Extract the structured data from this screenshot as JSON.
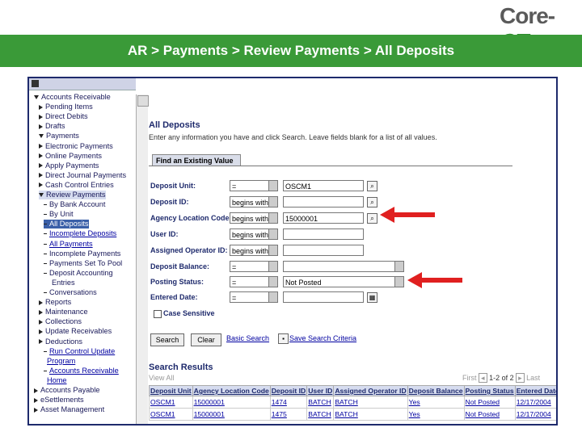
{
  "logo": {
    "core": "Core-",
    "ct": "CT"
  },
  "banner": {
    "title": "AR > Payments > Review Payments > All Deposits"
  },
  "nav": {
    "items": [
      {
        "label": "Accounts Receivable",
        "type": "open"
      },
      {
        "label": "Pending Items",
        "type": "closed"
      },
      {
        "label": "Direct Debits",
        "type": "closed"
      },
      {
        "label": "Drafts",
        "type": "closed"
      },
      {
        "label": "Payments",
        "type": "open"
      },
      {
        "label": "Electronic Payments",
        "type": "closed"
      },
      {
        "label": "Online Payments",
        "type": "closed"
      },
      {
        "label": "Apply Payments",
        "type": "closed"
      },
      {
        "label": "Direct Journal Payments",
        "type": "closed"
      },
      {
        "label": "Cash Control Entries",
        "type": "closed"
      },
      {
        "label": "Review Payments",
        "type": "open"
      },
      {
        "label": "By Bank Account",
        "type": "leaf"
      },
      {
        "label": "By Unit",
        "type": "leaf"
      },
      {
        "label": "All Deposits",
        "type": "leaf-hl"
      },
      {
        "label": "Incomplete Deposits",
        "type": "leaf-link"
      },
      {
        "label": "All Payments",
        "type": "leaf-link"
      },
      {
        "label": "Incomplete Payments",
        "type": "leaf"
      },
      {
        "label": "Payments Set To Pool",
        "type": "leaf"
      },
      {
        "label": "Deposit Accounting",
        "type": "leaf"
      },
      {
        "label": "Entries",
        "type": "cont"
      },
      {
        "label": "Conversations",
        "type": "leaf"
      },
      {
        "label": "Reports",
        "type": "closed"
      },
      {
        "label": "Maintenance",
        "type": "closed"
      },
      {
        "label": "Collections",
        "type": "closed"
      },
      {
        "label": "Update Receivables",
        "type": "closed"
      },
      {
        "label": "Deductions",
        "type": "closed"
      },
      {
        "label": "Run Control Update",
        "type": "leaf-link"
      },
      {
        "label": "Program",
        "type": "cont-link"
      },
      {
        "label": "Accounts Receivable",
        "type": "leaf-link"
      },
      {
        "label": "Home",
        "type": "cont-link"
      },
      {
        "label": "Accounts Payable",
        "type": "closed-top"
      },
      {
        "label": "eSettlements",
        "type": "closed-top"
      },
      {
        "label": "Asset Management",
        "type": "closed-top"
      }
    ]
  },
  "page": {
    "title": "All Deposits",
    "instructions": "Enter any information you have and click Search. Leave fields blank for a list of all values.",
    "tab": "Find an Existing Value"
  },
  "fields": [
    {
      "label": "Deposit Unit:",
      "op": "=",
      "value": "OSCM1",
      "lookup": true
    },
    {
      "label": "Deposit ID:",
      "op": "begins with",
      "value": "",
      "lookup": true
    },
    {
      "label": "Agency Location Code:",
      "op": "begins with",
      "value": "15000001",
      "lookup": true
    },
    {
      "label": "User ID:",
      "op": "begins with",
      "value": "",
      "lookup": false
    },
    {
      "label": "Assigned Operator ID:",
      "op": "begins with",
      "value": "",
      "lookup": false
    },
    {
      "label": "Deposit Balance:",
      "op": "=",
      "value": "",
      "lookup": false,
      "select": true
    },
    {
      "label": "Posting Status:",
      "op": "=",
      "value": "Not Posted",
      "lookup": false,
      "select": true
    },
    {
      "label": "Entered Date:",
      "op": "=",
      "value": "",
      "lookup": false,
      "calendar": true
    }
  ],
  "case_sensitive": "Case Sensitive",
  "buttons": {
    "search": "Search",
    "clear": "Clear",
    "basic": "Basic Search",
    "save": "Save Search Criteria"
  },
  "results": {
    "title": "Search Results",
    "view_all": "View All",
    "pager": {
      "first": "First",
      "range": "1-2 of 2",
      "last": "Last"
    },
    "columns": [
      "Deposit Unit",
      "Agency Location Code",
      "Deposit ID",
      "User ID",
      "Assigned Operator ID",
      "Deposit Balance",
      "Posting Status",
      "Entered Date"
    ],
    "rows": [
      [
        "OSCM1",
        "15000001",
        "1474",
        "BATCH",
        "BATCH",
        "Yes",
        "Not Posted",
        "12/17/2004"
      ],
      [
        "OSCM1",
        "15000001",
        "1475",
        "BATCH",
        "BATCH",
        "Yes",
        "Not Posted",
        "12/17/2004"
      ]
    ]
  },
  "colors": {
    "banner": "#3a9a38",
    "arrow": "#e02020",
    "border": "#1e2a6c"
  }
}
